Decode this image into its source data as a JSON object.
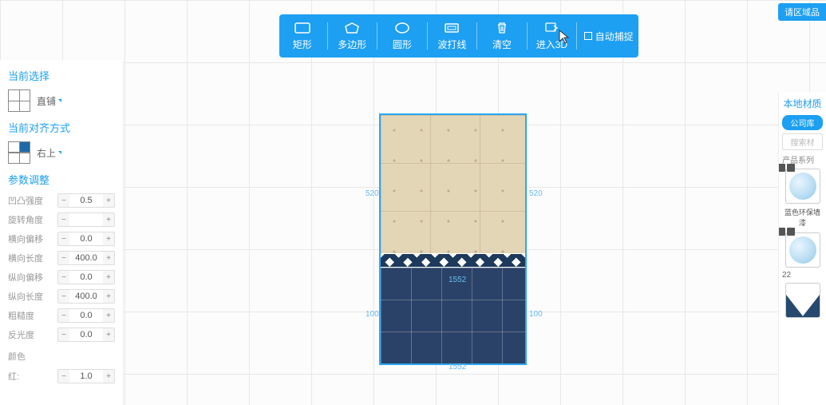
{
  "toolbar": {
    "tools": [
      "矩形",
      "多边形",
      "圆形",
      "波打线",
      "清空",
      "进入3D"
    ],
    "auto_capture": "自动捕捉"
  },
  "region_label": "请区域品",
  "left": {
    "section_selection": "当前选择",
    "selection_label": "直铺",
    "section_align": "当前对齐方式",
    "align_label": "右上",
    "section_params": "参数调整",
    "params": [
      {
        "label": "凹凸强度",
        "value": "0.5"
      },
      {
        "label": "旋转角度",
        "value": ""
      },
      {
        "label": "横向偏移",
        "value": "0.0"
      },
      {
        "label": "横向长度",
        "value": "400.0"
      },
      {
        "label": "纵向偏移",
        "value": "0.0"
      },
      {
        "label": "纵向长度",
        "value": "400.0"
      },
      {
        "label": "粗糙度",
        "value": "0.0"
      },
      {
        "label": "反光度",
        "value": "0.0"
      }
    ],
    "color_label": "颜色",
    "r_label": "红:",
    "r_value": "1.0"
  },
  "right": {
    "title": "本地材质",
    "tab": "公司库",
    "search_placeholder": "搜索材",
    "series_label": "产品系列",
    "swatch1_label": "蓝色环保墙漆",
    "count": "22"
  },
  "dims": {
    "l1": "520",
    "r1": "520",
    "l2": "100",
    "r2": "100",
    "b1": "1552",
    "b2": "1552"
  }
}
